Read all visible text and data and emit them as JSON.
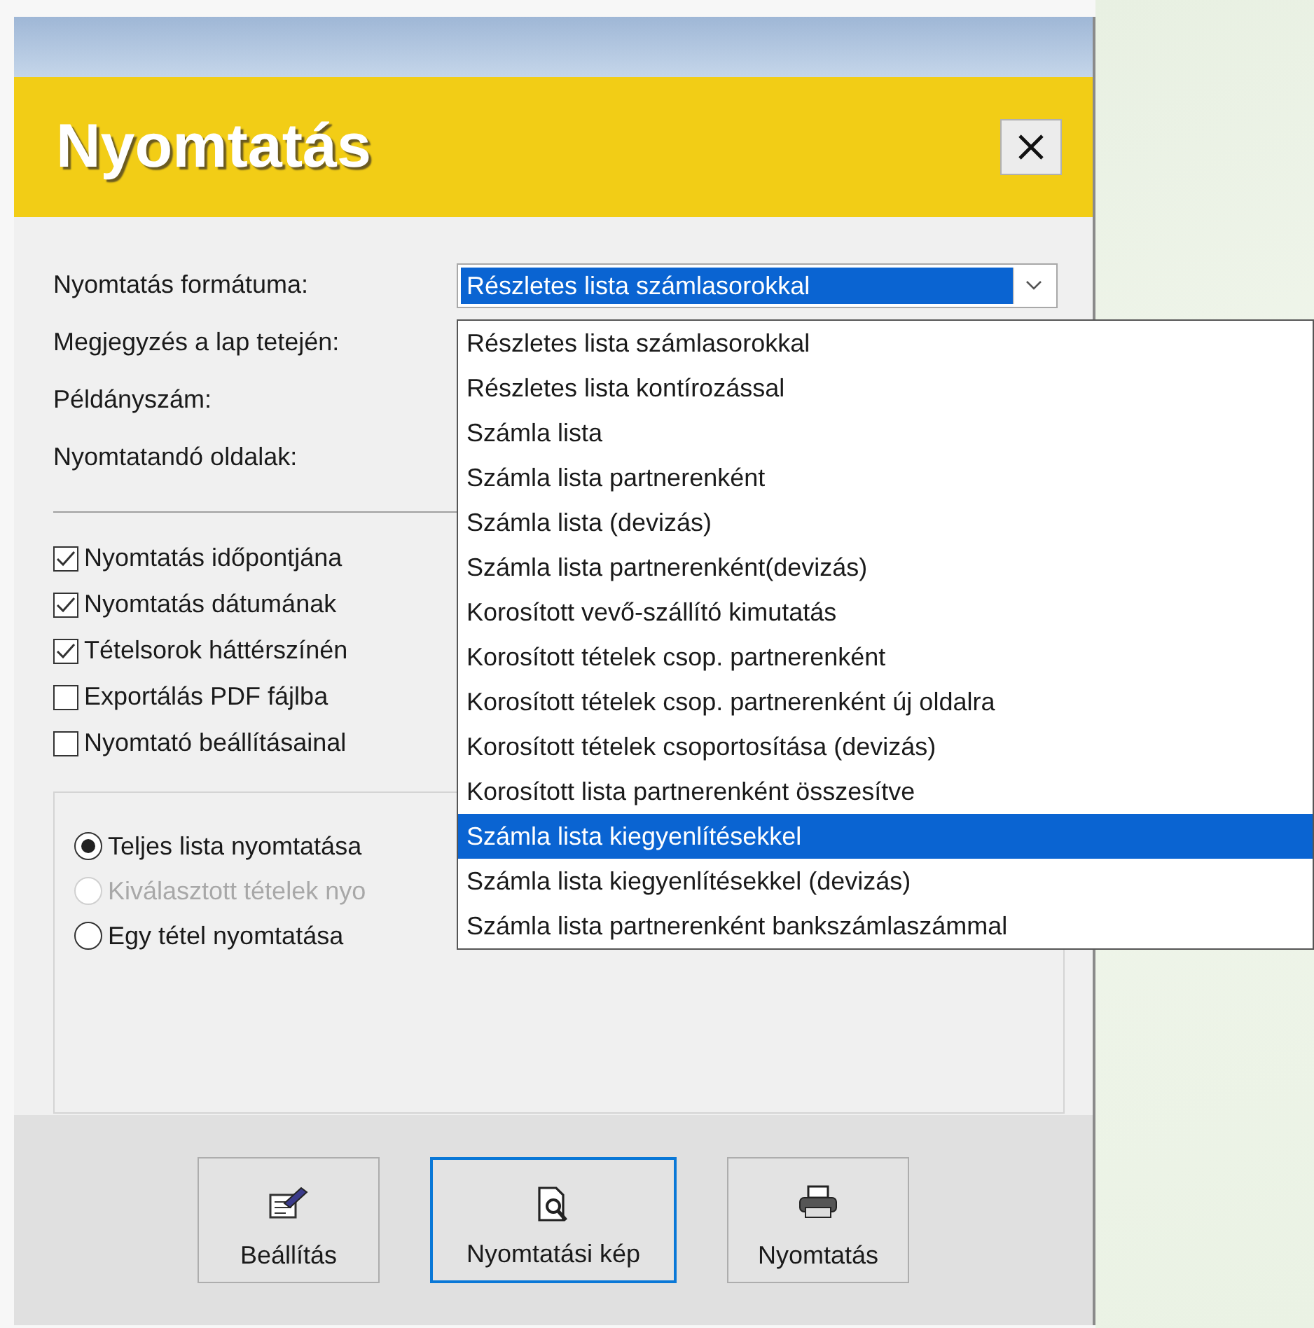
{
  "dialog": {
    "title": "Nyomtatás"
  },
  "format": {
    "label": "Nyomtatás formátuma:",
    "value": "Részletes lista számlasorokkal",
    "expanded": true,
    "options": [
      {
        "label": "Részletes lista számlasorokkal",
        "highlighted": false
      },
      {
        "label": "Részletes lista kontírozással",
        "highlighted": false
      },
      {
        "label": "Számla lista",
        "highlighted": false
      },
      {
        "label": "Számla lista partnerenként",
        "highlighted": false
      },
      {
        "label": "Számla lista (devizás)",
        "highlighted": false
      },
      {
        "label": "Számla lista partnerenként(devizás)",
        "highlighted": false
      },
      {
        "label": "Korosított vevő-szállító kimutatás",
        "highlighted": false
      },
      {
        "label": "Korosított tételek csop. partnerenként",
        "highlighted": false
      },
      {
        "label": "Korosított tételek csop. partnerenként új oldalra",
        "highlighted": false
      },
      {
        "label": "Korosított tételek csoportosítása (devizás)",
        "highlighted": false
      },
      {
        "label": "Korosított lista partnerenként összesítve",
        "highlighted": false
      },
      {
        "label": "Számla lista kiegyenlítésekkel",
        "highlighted": true
      },
      {
        "label": "Számla lista kiegyenlítésekkel (devizás)",
        "highlighted": false
      },
      {
        "label": "Számla lista partnerenként bankszámlaszámmal",
        "highlighted": false
      }
    ]
  },
  "fields": [
    {
      "label": "Megjegyzés a lap tetején:"
    },
    {
      "label": "Példányszám:"
    },
    {
      "label": "Nyomtatandó oldalak:"
    }
  ],
  "checkboxes": [
    {
      "label": "Nyomtatás időpontjána",
      "checked": true
    },
    {
      "label": "Nyomtatás dátumának",
      "checked": true
    },
    {
      "label": "Tételsorok háttérszínén",
      "checked": true
    },
    {
      "label": "Exportálás PDF fájlba",
      "checked": false
    },
    {
      "label": "Nyomtató beállításainal",
      "checked": false
    }
  ],
  "radios": [
    {
      "label": "Teljes lista nyomtatása",
      "selected": true,
      "disabled": false
    },
    {
      "label": "Kiválasztott tételek nyo",
      "selected": false,
      "disabled": true
    },
    {
      "label": "Egy tétel nyomtatása",
      "selected": false,
      "disabled": false
    }
  ],
  "buttons": [
    {
      "label": "Beállítás",
      "kind": "settings",
      "focused": false
    },
    {
      "label": "Nyomtatási kép",
      "kind": "preview",
      "focused": true
    },
    {
      "label": "Nyomtatás",
      "kind": "print",
      "focused": false
    }
  ]
}
